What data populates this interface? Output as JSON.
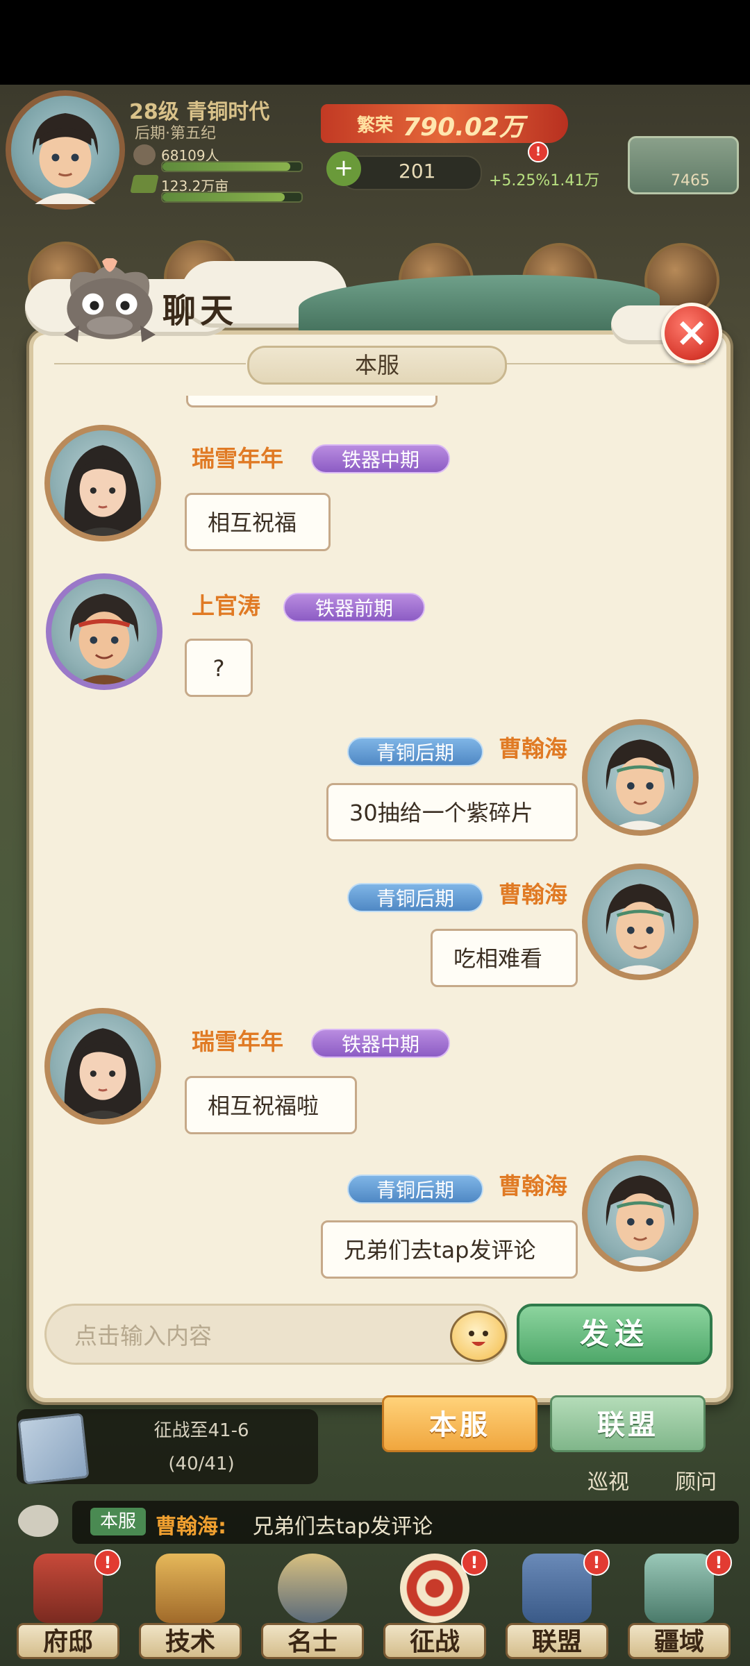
{
  "hud": {
    "level_era": "28级 青铜时代",
    "sub_era": "后期·第五纪",
    "population": "68109人",
    "land": "123.2万亩",
    "prosperity_label": "繁荣",
    "prosperity_value": "790.02万",
    "food": "201",
    "growth": "+5.25%1.41万",
    "gold": "7465"
  },
  "panel": {
    "title": "聊天",
    "tab": "本服",
    "close": "×"
  },
  "messages": [
    {
      "name": "瑞雪年年",
      "rank": "铁器中期",
      "text": "相互祝福",
      "side": "left"
    },
    {
      "name": "上官涛",
      "rank": "铁器前期",
      "text": "?",
      "side": "left"
    },
    {
      "name": "曹翰海",
      "rank": "青铜后期",
      "text": "30抽给一个紫碎片",
      "side": "right"
    },
    {
      "name": "曹翰海",
      "rank": "青铜后期",
      "text": "吃相难看",
      "side": "right"
    },
    {
      "name": "瑞雪年年",
      "rank": "铁器中期",
      "text": "相互祝福啦",
      "side": "left"
    },
    {
      "name": "曹翰海",
      "rank": "青铜后期",
      "text": "兄弟们去tap发评论",
      "side": "right"
    }
  ],
  "input": {
    "placeholder": "点击输入内容",
    "send": "发送"
  },
  "bottom": {
    "tab_server": "本服",
    "tab_alliance": "联盟",
    "quest_text": "征战至41-6",
    "quest_progress": "(40/41)",
    "patrol": "巡视",
    "advisor": "顾问",
    "ticker_channel": "本服",
    "ticker_name": "曹翰海:",
    "ticker_text": "兄弟们去tap发评论"
  },
  "nav": [
    "府邸",
    "技术",
    "名士",
    "征战",
    "联盟",
    "疆域"
  ],
  "colors": {
    "name_orange": "#e07a24",
    "rank_iron": "#8c5cc4",
    "rank_bronze": "#4f88c4",
    "send_green": "#4fa86a",
    "tab_active": "#f5b04a"
  }
}
